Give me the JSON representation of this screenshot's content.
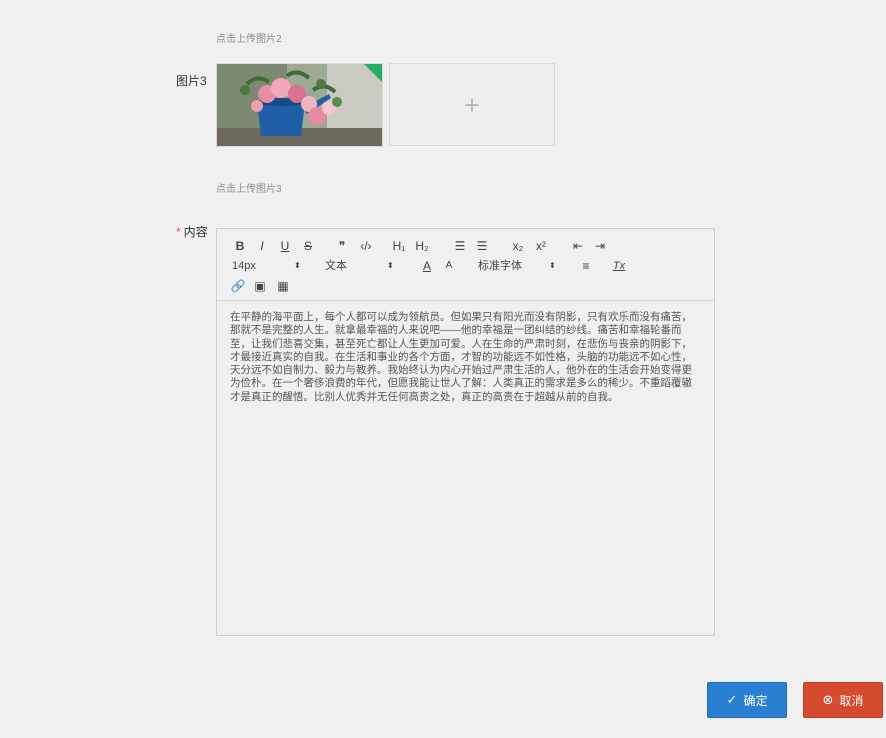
{
  "upload2": {
    "hint": "点击上传图片2"
  },
  "upload3": {
    "label": "图片3",
    "hint": "点击上传图片3",
    "add_icon": "+",
    "image_alt": "pink roses in blue watering can"
  },
  "content_field": {
    "required_mark": "*",
    "label": "内容",
    "text": "在平静的海平面上，每个人都可以成为领航员。但如果只有阳光而没有阴影，只有欢乐而没有痛苦，那就不是完整的人生。就拿最幸福的人来说吧——他的幸福是一团纠结的纱线。痛苦和幸福轮番而至，让我们悲喜交集，甚至死亡都让人生更加可爱。人在生命的严肃时刻，在悲伤与丧亲的阴影下，才最接近真实的自我。在生活和事业的各个方面，才智的功能远不如性格，头脑的功能远不如心性，天分远不如自制力、毅力与教养。我始终认为内心开始过严肃生活的人，他外在的生活会开始变得更为俭朴。在一个奢侈浪费的年代，但愿我能让世人了解：人类真正的需求是多么的稀少。不重蹈覆辙才是真正的醒悟。比别人优秀并无任何高贵之处，真正的高贵在于超越从前的自我。"
  },
  "toolbar": {
    "row1": [
      {
        "name": "bold-button",
        "label": "B"
      },
      {
        "name": "italic-button",
        "label": "I"
      },
      {
        "name": "underline-button",
        "label": "U"
      },
      {
        "name": "strike-button",
        "label": "S"
      },
      {
        "name": "blockquote-button",
        "label": "❞"
      },
      {
        "name": "code-block-button",
        "label": "‹/›"
      },
      {
        "name": "header1-button",
        "label": "H₁"
      },
      {
        "name": "header2-button",
        "label": "H₂"
      },
      {
        "name": "ordered-list-button",
        "label": "☰"
      },
      {
        "name": "bullet-list-button",
        "label": "☰"
      },
      {
        "name": "subscript-button",
        "label": "x₂"
      },
      {
        "name": "superscript-button",
        "label": "x²"
      },
      {
        "name": "outdent-button",
        "label": "⇤"
      },
      {
        "name": "indent-button",
        "label": "⇥"
      }
    ],
    "size_select": "14px",
    "header_select": "文本",
    "font_select": "标准字体",
    "select_caret": "⬍",
    "color_icon": "A",
    "background_icon": "A",
    "align_icon": "≡",
    "clean_icon": "Tx",
    "row3": [
      {
        "name": "link-icon",
        "label": "🔗"
      },
      {
        "name": "image-icon",
        "label": "▣"
      },
      {
        "name": "video-icon",
        "label": "▦"
      }
    ]
  },
  "buttons": {
    "ok_icon": "✓",
    "ok_label": "确定",
    "cancel_icon": "⊗",
    "cancel_label": "取消"
  }
}
